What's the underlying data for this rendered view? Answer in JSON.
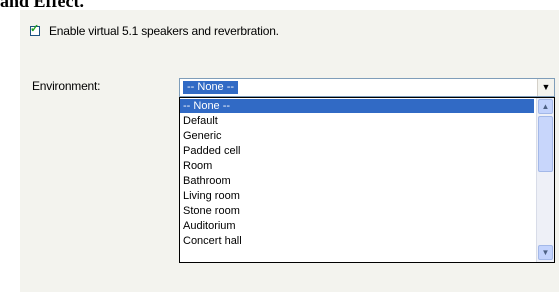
{
  "caption": "and Effect.",
  "reverb_checkbox": {
    "checked": true,
    "label": "Enable virtual 5.1 speakers and reverbration."
  },
  "environment": {
    "label": "Environment:",
    "selected_value": "-- None --",
    "options": [
      "-- None --",
      "Default",
      "Generic",
      "Padded cell",
      "Room",
      "Bathroom",
      "Living room",
      "Stone room",
      "Auditorium",
      "Concert hall"
    ]
  },
  "colors": {
    "selection": "#316ac5",
    "panel_background": "#f3f3ee",
    "checkmark": "#21a121"
  },
  "icons": {
    "dropdown_arrow": "chevron-down-icon",
    "scroll_up": "chevron-up-icon",
    "scroll_down": "chevron-down-icon"
  }
}
